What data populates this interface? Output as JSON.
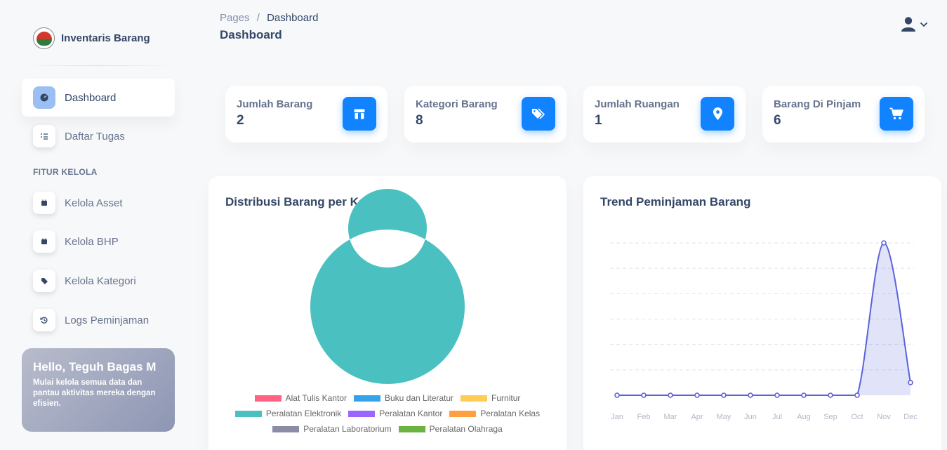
{
  "brand": {
    "name": "Inventaris Barang"
  },
  "sidebar": {
    "items": [
      {
        "label": "Dashboard",
        "icon": "dashboard-icon",
        "active": true
      },
      {
        "label": "Daftar Tugas",
        "icon": "task-list-icon"
      }
    ],
    "section_title": "FITUR KELOLA",
    "manage_items": [
      {
        "label": "Kelola Asset",
        "icon": "calendar-icon"
      },
      {
        "label": "Kelola BHP",
        "icon": "calendar-icon"
      },
      {
        "label": "Kelola Kategori",
        "icon": "tags-icon"
      },
      {
        "label": "Logs Peminjaman",
        "icon": "history-icon"
      }
    ]
  },
  "hello_card": {
    "title": "Hello, Teguh Bagas M",
    "text": "Mulai kelola semua data dan pantau aktivitas mereka dengan efisien."
  },
  "header": {
    "breadcrumb_root": "Pages",
    "breadcrumb_sep": "/",
    "breadcrumb_current": "Dashboard",
    "title": "Dashboard"
  },
  "stats": [
    {
      "label": "Jumlah Barang",
      "value": "2",
      "icon": "box-icon"
    },
    {
      "label": "Kategori Barang",
      "value": "8",
      "icon": "tags-icon"
    },
    {
      "label": "Jumlah Ruangan",
      "value": "1",
      "icon": "map-pin-icon"
    },
    {
      "label": "Barang Di Pinjam",
      "value": "6",
      "icon": "cart-icon"
    }
  ],
  "colors": {
    "accent": "#1183ff",
    "active_icon_bg": "#9bbff3",
    "line": "#5b63d9"
  },
  "chart_data": [
    {
      "type": "pie",
      "title": "Distribusi Barang per Kategori",
      "donut": true,
      "categories": [
        "Alat Tulis Kantor",
        "Buku dan Literatur",
        "Furnitur",
        "Peralatan Elektronik",
        "Peralatan Kantor",
        "Peralatan Kelas",
        "Peralatan Laboratorium",
        "Peralatan Olahraga"
      ],
      "values": [
        0,
        0,
        0,
        2,
        0,
        0,
        0,
        0
      ],
      "colors": [
        "#ff6384",
        "#36a2eb",
        "#ffcd56",
        "#4bc0c0",
        "#9966ff",
        "#ff9f40",
        "#8c8ca6",
        "#6bb340"
      ],
      "legend": "bottom"
    },
    {
      "type": "area",
      "title": "Trend Peminjaman Barang",
      "categories": [
        "Jan",
        "Feb",
        "Mar",
        "Apr",
        "May",
        "Jun",
        "Jul",
        "Aug",
        "Sep",
        "Oct",
        "Nov",
        "Dec"
      ],
      "values": [
        0,
        0,
        0,
        0,
        0,
        0,
        0,
        0,
        0,
        0,
        6,
        0.5
      ],
      "ylim": [
        0,
        6
      ],
      "grid": true
    }
  ]
}
